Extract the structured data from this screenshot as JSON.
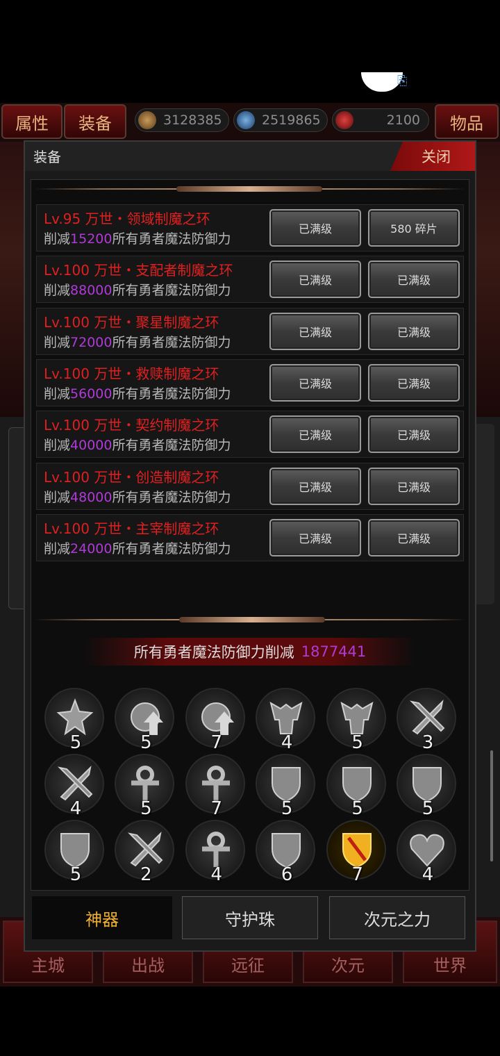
{
  "top_tabs": {
    "left1": "属性",
    "left2": "装备",
    "right": "物品"
  },
  "resources": [
    {
      "icon": "bronze-medal-icon",
      "value": "3128385",
      "color": "#8a6a3a"
    },
    {
      "icon": "blue-orb-icon",
      "value": "2519865",
      "color": "#3a6a9a"
    },
    {
      "icon": "red-emblem-icon",
      "value": "2100",
      "color": "#9a1a1a"
    }
  ],
  "modal": {
    "title": "装备",
    "close_label": "关闭"
  },
  "rings": [
    {
      "name": "Lv.95 万世・领域制魔之环",
      "desc_prefix": "削减",
      "value": "15200",
      "desc_suffix": "所有勇者魔法防御力",
      "btn1": "已满级",
      "btn2": "580 碎片"
    },
    {
      "name": "Lv.100 万世・支配者制魔之环",
      "desc_prefix": "削减",
      "value": "88000",
      "desc_suffix": "所有勇者魔法防御力",
      "btn1": "已满级",
      "btn2": "已满级"
    },
    {
      "name": "Lv.100 万世・聚星制魔之环",
      "desc_prefix": "削减",
      "value": "72000",
      "desc_suffix": "所有勇者魔法防御力",
      "btn1": "已满级",
      "btn2": "已满级"
    },
    {
      "name": "Lv.100 万世・救赎制魔之环",
      "desc_prefix": "削减",
      "value": "56000",
      "desc_suffix": "所有勇者魔法防御力",
      "btn1": "已满级",
      "btn2": "已满级"
    },
    {
      "name": "Lv.100 万世・契约制魔之环",
      "desc_prefix": "削减",
      "value": "40000",
      "desc_suffix": "所有勇者魔法防御力",
      "btn1": "已满级",
      "btn2": "已满级"
    },
    {
      "name": "Lv.100 万世・创造制魔之环",
      "desc_prefix": "削减",
      "value": "48000",
      "desc_suffix": "所有勇者魔法防御力",
      "btn1": "已满级",
      "btn2": "已满级"
    },
    {
      "name": "Lv.100 万世・主宰制魔之环",
      "desc_prefix": "削减",
      "value": "24000",
      "desc_suffix": "所有勇者魔法防御力",
      "btn1": "已满级",
      "btn2": "已满级"
    }
  ],
  "total": {
    "label": "所有勇者魔法防御力削减",
    "value": "1877441"
  },
  "medals": [
    {
      "icon": "star-icon",
      "level": "5"
    },
    {
      "icon": "spiked-orb-icon",
      "level": "5"
    },
    {
      "icon": "spiked-orb-up-icon",
      "level": "7"
    },
    {
      "icon": "armor-icon",
      "level": "4"
    },
    {
      "icon": "armor-up-icon",
      "level": "5"
    },
    {
      "icon": "crossed-swords-icon",
      "level": "3"
    },
    {
      "icon": "sword-up-icon",
      "level": "4"
    },
    {
      "icon": "ankh-icon",
      "level": "5"
    },
    {
      "icon": "ankh-up-icon",
      "level": "7"
    },
    {
      "icon": "shield-icon",
      "level": "5"
    },
    {
      "icon": "shield-up-icon",
      "level": "5"
    },
    {
      "icon": "crest-shield-icon",
      "level": "5"
    },
    {
      "icon": "crest-shield-up-icon",
      "level": "5"
    },
    {
      "icon": "broken-swords-icon",
      "level": "2"
    },
    {
      "icon": "broken-ankh-icon",
      "level": "4"
    },
    {
      "icon": "broken-shield-icon",
      "level": "6"
    },
    {
      "icon": "golden-broken-crest-icon",
      "level": "7"
    },
    {
      "icon": "broken-heart-icon",
      "level": "4"
    }
  ],
  "bottom_tabs": {
    "tab1": "神器",
    "tab2": "守护珠",
    "tab3": "次元之力"
  },
  "bg_nav": {
    "item1": "主城",
    "item2": "出战",
    "item3": "远征",
    "item4": "次元",
    "item5": "世界"
  }
}
